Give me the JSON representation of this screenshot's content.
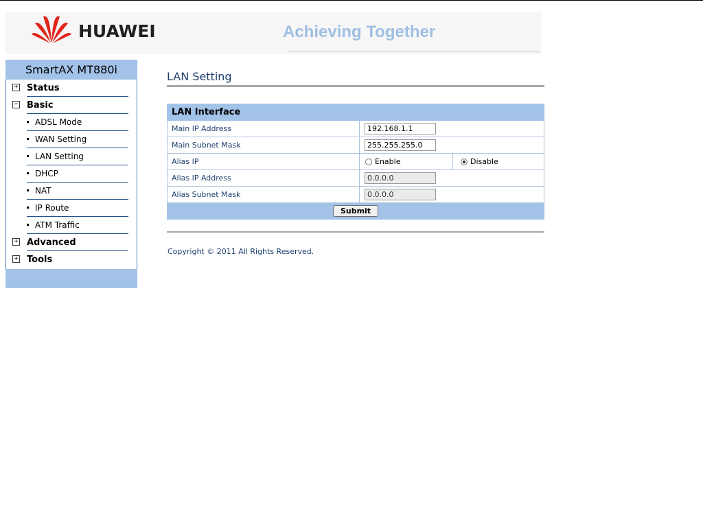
{
  "header": {
    "brand": "HUAWEI",
    "slogan": "Achieving Together",
    "brand_color": "#e1251b",
    "slogan_color": "#9fbfe3"
  },
  "sidebar": {
    "title": "SmartAX MT880i",
    "items": [
      {
        "label": "Status",
        "icon": "plus-box-icon"
      },
      {
        "label": "Basic",
        "icon": "minus-box-icon",
        "children": [
          "ADSL Mode",
          "WAN Setting",
          "LAN Setting",
          "DHCP",
          "NAT",
          "IP Route",
          "ATM Traffic"
        ]
      },
      {
        "label": "Advanced",
        "icon": "plus-box-icon"
      },
      {
        "label": "Tools",
        "icon": "plus-box-icon"
      }
    ]
  },
  "main": {
    "title": "LAN Setting",
    "section": "LAN Interface",
    "fields": {
      "main_ip": {
        "label": "Main IP Address",
        "value": "192.168.1.1"
      },
      "main_mask": {
        "label": "Main Subnet Mask",
        "value": "255.255.255.0"
      },
      "alias_ip": {
        "label": "Alias IP",
        "enable": "Enable",
        "disable": "Disable",
        "selected": "Disable"
      },
      "alias_addr": {
        "label": "Alias IP Address",
        "value": "0.0.0.0"
      },
      "alias_mask": {
        "label": "Alias Subnet Mask",
        "value": "0.0.0.0"
      }
    },
    "submit": "Submit",
    "copyright": "Copyright © 2011 All Rights Reserved."
  },
  "colors": {
    "accent": "#a2c2e8",
    "text_blue": "#1d3f6e"
  }
}
